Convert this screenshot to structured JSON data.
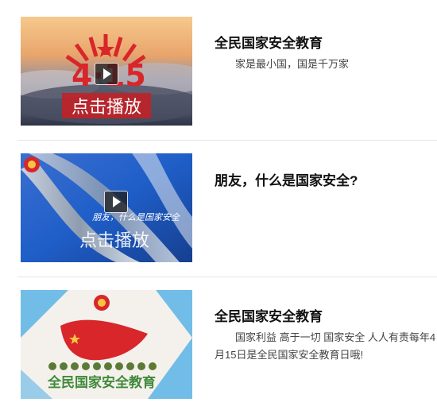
{
  "items": [
    {
      "title": "全民国家安全教育",
      "description": "家是最小国，国是千万家",
      "thumb_overlay": "点击播放",
      "thumb_badge": "4·15"
    },
    {
      "title": "朋友，什么是国家安全?",
      "description": "",
      "thumb_overlay": "点击播放",
      "thumb_caption": "朋友，什么是国家安全"
    },
    {
      "title": "全民国家安全教育",
      "description": "国家利益 高于一切 国家安全 人人有责每年4月15日是全民国家安全教育日哦!",
      "thumb_caption": "全民国家安全教育"
    }
  ],
  "colors": {
    "accent_red": "#d8262b",
    "divider": "#e5e5e5"
  }
}
